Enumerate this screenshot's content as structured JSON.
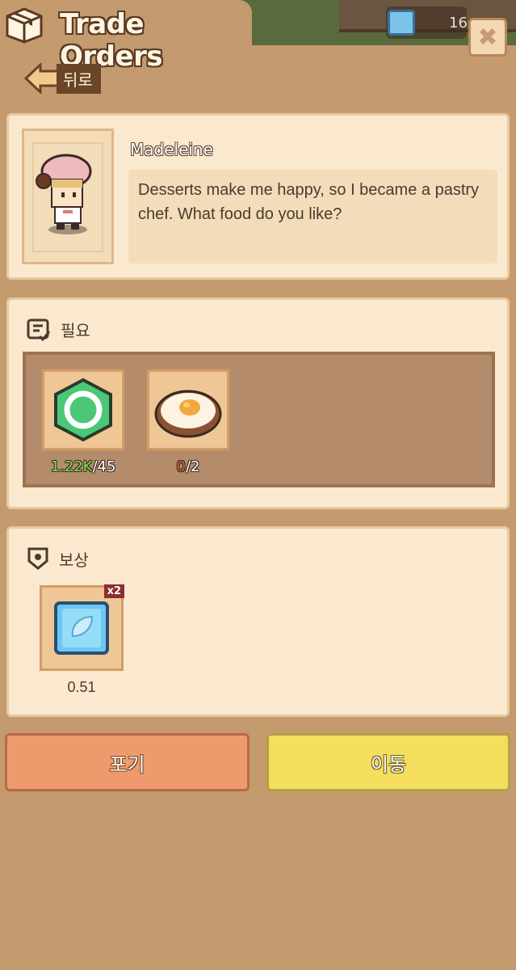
{
  "header": {
    "title": "Trade Orders",
    "currency_count": "16",
    "icons": {
      "title": "box-icon",
      "close": "close-icon",
      "currency": "gem-icon"
    }
  },
  "back": {
    "label": "뒤로"
  },
  "npc": {
    "name": "Madeleine",
    "dialogue": "Desserts make me happy, so I became a pastry chef. What food do you like?"
  },
  "requirements": {
    "label": "필요",
    "items": [
      {
        "icon": "green-token-icon",
        "have": "1.22K",
        "need": "/45",
        "fulfilled": true
      },
      {
        "icon": "fried-egg-icon",
        "have": "0",
        "need": "/2",
        "fulfilled": false
      }
    ]
  },
  "reward": {
    "label": "보상",
    "items": [
      {
        "icon": "blue-gem-icon",
        "multiplier": "x2",
        "value": "0.51"
      }
    ]
  },
  "actions": {
    "give_up": "포기",
    "move": "이동"
  },
  "colors": {
    "background": "#c49a6f",
    "panel": "#fbe9cf",
    "give_up_button": "#ee9a6c",
    "move_button": "#f5de5e",
    "have_ok": "#7fe04c",
    "have_bad": "#d4663a"
  }
}
